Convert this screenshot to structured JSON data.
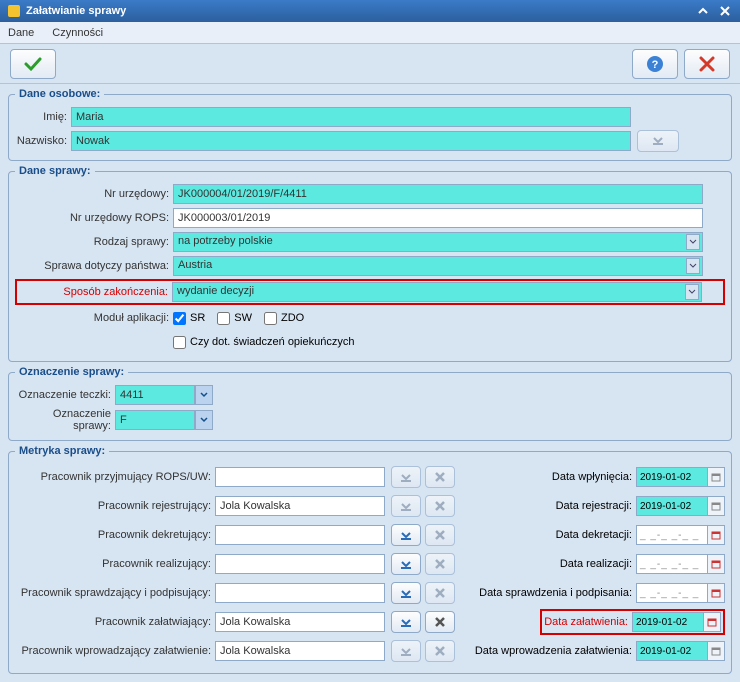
{
  "title": "Załatwianie sprawy",
  "menu": {
    "dane": "Dane",
    "czynnosci": "Czynności"
  },
  "sections": {
    "osobowe": "Dane osobowe:",
    "sprawy": "Dane sprawy:",
    "oznaczenie": "Oznaczenie sprawy:",
    "metryka": "Metryka sprawy:"
  },
  "labels": {
    "imie": "Imię:",
    "nazwisko": "Nazwisko:",
    "nr_urzedowy": "Nr urzędowy:",
    "nr_rops": "Nr urzędowy ROPS:",
    "rodzaj": "Rodzaj sprawy:",
    "panstwo": "Sprawa dotyczy państwa:",
    "sposob": "Sposób zakończenia:",
    "modul": "Moduł aplikacji:",
    "czy_dot": "Czy dot. świadczeń opiekuńczych",
    "ozn_teczki": "Oznaczenie teczki:",
    "ozn_sprawy": "Oznaczenie sprawy:",
    "prac_przyjm": "Pracownik przyjmujący ROPS/UW:",
    "prac_rej": "Pracownik rejestrujący:",
    "prac_dekr": "Pracownik dekretujący:",
    "prac_real": "Pracownik realizujący:",
    "prac_spr": "Pracownik sprawdzający i podpisujący:",
    "prac_zal": "Pracownik załatwiający:",
    "prac_wpr": "Pracownik wprowadzający załatwienie:",
    "data_wpl": "Data wpłynięcia:",
    "data_rej": "Data rejestracji:",
    "data_dekr": "Data dekretacji:",
    "data_real": "Data realizacji:",
    "data_spr": "Data sprawdzenia i podpisania:",
    "data_zal": "Data załatwienia:",
    "data_wpr": "Data wprowadzenia załatwienia:"
  },
  "values": {
    "imie": "Maria",
    "nazwisko": "Nowak",
    "nr_urzedowy": "JK000004/01/2019/F/4411",
    "nr_rops": "JK000003/01/2019",
    "rodzaj": "na potrzeby polskie",
    "panstwo": "Austria",
    "sposob": "wydanie decyzji",
    "ozn_teczki": "4411",
    "ozn_sprawy": "F",
    "prac_rej": "Jola Kowalska",
    "prac_zal": "Jola Kowalska",
    "prac_wpr": "Jola Kowalska",
    "data_wpl": "2019-01-02",
    "data_rej": "2019-01-02",
    "data_zal": "2019-01-02",
    "data_wpr": "2019-01-02",
    "empty_date": "_ _-_ _-_ _"
  },
  "modules": {
    "sr": "SR",
    "sw": "SW",
    "zdo": "ZDO"
  }
}
